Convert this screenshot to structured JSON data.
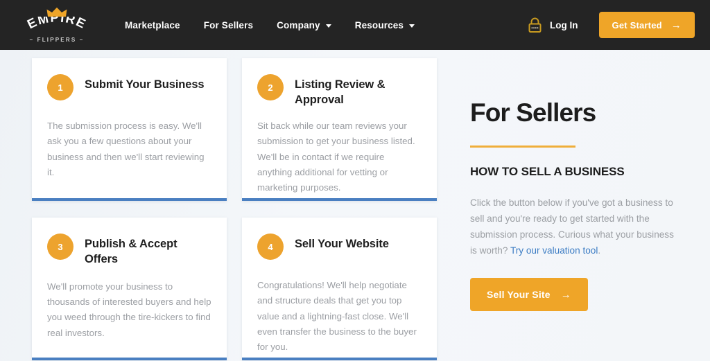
{
  "header": {
    "logo": {
      "name": "EMPIRE",
      "sub": "– FLIPPERS –",
      "crown_icon": "crown-icon",
      "crown_color": "#efa528"
    },
    "nav": [
      {
        "label": "Marketplace",
        "has_caret": false
      },
      {
        "label": "For Sellers",
        "has_caret": false
      },
      {
        "label": "Company",
        "has_caret": true
      },
      {
        "label": "Resources",
        "has_caret": true
      }
    ],
    "login": {
      "label": "Log In",
      "icon": "padlock-icon"
    },
    "cta": {
      "label": "Get Started",
      "arrow": "→"
    },
    "background": "#242424"
  },
  "steps": [
    {
      "number": "1",
      "title": "Submit Your Business",
      "body": "The submission process is easy. We'll ask you a few questions about your business and then we'll start reviewing it."
    },
    {
      "number": "2",
      "title": "Listing Review & Approval",
      "body": "Sit back while our team reviews your submission to get your business listed. We'll be in contact if we require anything additional for vetting or marketing purposes."
    },
    {
      "number": "3",
      "title": "Publish & Accept Offers",
      "body": "We'll promote your business to thousands of interested buyers and help you weed through the tire-kickers to find real investors."
    },
    {
      "number": "4",
      "title": "Sell Your Website",
      "body": "Congratulations! We'll help negotiate and structure deals that get you top value and a lightning-fast close. We'll even transfer the business to the buyer for you."
    }
  ],
  "sidebar": {
    "title": "For Sellers",
    "subhead": "HOW TO SELL A BUSINESS",
    "body_before_link": "Click the button below if you've got a business to sell and you're ready to get started with the submission process. Curious what your business is worth? ",
    "link_label": "Try our valuation tool",
    "body_after_link": ".",
    "cta": {
      "label": "Sell Your Site",
      "arrow": "→"
    }
  },
  "colors": {
    "accent_orange": "#efa528",
    "badge_orange": "#eda32e",
    "card_border_blue": "#4a7fc1",
    "link_blue": "#3c7cc4",
    "header_dark": "#242424",
    "muted_text": "#9b9ea3"
  }
}
